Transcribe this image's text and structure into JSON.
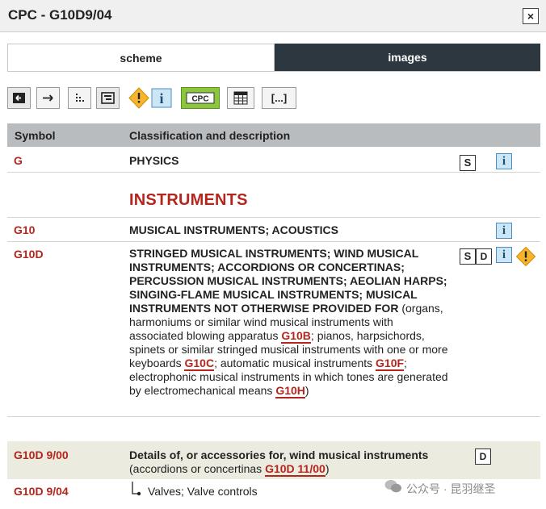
{
  "window": {
    "title": "CPC - G10D9/04",
    "close_label": "×"
  },
  "tabs": [
    {
      "label": "scheme",
      "active": true
    },
    {
      "label": "images",
      "active": false
    }
  ],
  "toolbar": {
    "buttons": [
      {
        "icon": "first-icon"
      },
      {
        "icon": "next-icon"
      },
      {
        "icon": "tree-icon"
      },
      {
        "icon": "outline-icon"
      },
      {
        "icon": "warning-icon"
      },
      {
        "icon": "info-icon"
      },
      {
        "icon": "cpc-icon",
        "label": "CPC"
      },
      {
        "icon": "table-icon"
      },
      {
        "icon": "ellipsis-icon",
        "label": "[...]"
      }
    ]
  },
  "table": {
    "headers": {
      "symbol": "Symbol",
      "description": "Classification and description"
    },
    "rows": [
      {
        "symbol": "G",
        "desc": "PHYSICS"
      },
      {
        "heading": "INSTRUMENTS"
      },
      {
        "symbol": "G10",
        "desc": "MUSICAL INSTRUMENTS; ACOUSTICS"
      },
      {
        "symbol": "G10D",
        "desc_bold": "STRINGED MUSICAL INSTRUMENTS; WIND MUSICAL INSTRUMENTS; ACCORDIONS OR CONCERTINAS; PERCUSSION MUSICAL INSTRUMENTS; AEOLIAN HARPS; SINGING-FLAME MUSICAL INSTRUMENTS; MUSICAL INSTRUMENTS NOT OTHERWISE PROVIDED FOR",
        "desc_rest_1": " (organs, harmoniums or similar wind musical instruments with associated blowing apparatus ",
        "ref_1": "G10B",
        "desc_rest_2": "; pianos, harpsichords, spinets or similar stringed musical instruments with one or more keyboards ",
        "ref_2": "G10C",
        "desc_rest_3": "; automatic musical instruments ",
        "ref_3": "G10F",
        "desc_rest_4": "; electrophonic musical instruments in which tones are generated by electromechanical means ",
        "ref_4": "G10H",
        "desc_rest_5": ")"
      },
      {
        "symbol": "G10D 9/00",
        "desc_bold": "Details of, or accessories for, wind musical instruments",
        "desc_rest_1": " (accordions or concertinas ",
        "ref_1": "G10D 11/00",
        "desc_rest_2": ")"
      },
      {
        "symbol": "G10D 9/04",
        "desc": "Valves; Valve controls"
      }
    ]
  },
  "icons": {
    "s": "S",
    "d": "D",
    "i": "i"
  },
  "watermark": {
    "text": "公众号 · 昆羽继圣"
  },
  "colors": {
    "symbol_red": "#b3261e",
    "header_bg": "#b8bcbf",
    "tab_dark": "#2d3740",
    "highlight_bg": "#ecebe0"
  }
}
